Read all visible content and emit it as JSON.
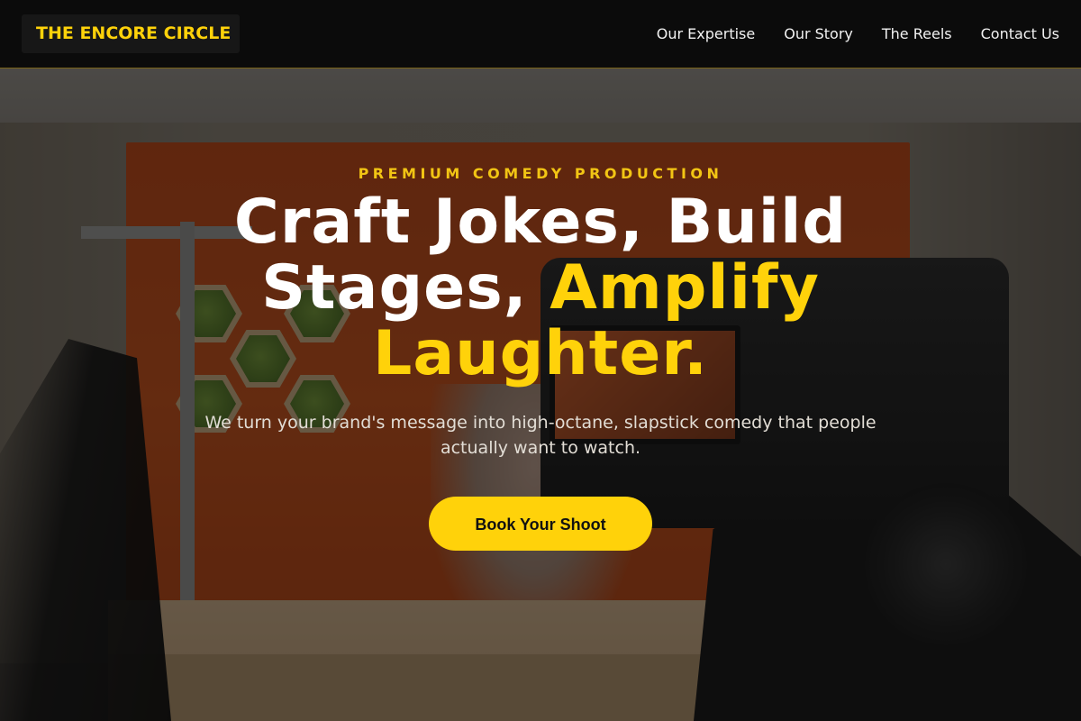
{
  "brand": {
    "name": "THE ENCORE CIRCLE"
  },
  "nav": {
    "items": [
      {
        "label": "Our Expertise"
      },
      {
        "label": "Our Story"
      },
      {
        "label": "The Reels"
      },
      {
        "label": "Contact Us"
      }
    ]
  },
  "hero": {
    "eyebrow": "PREMIUM COMEDY PRODUCTION",
    "headline_part1": "Craft Jokes, Build Stages, ",
    "headline_accent": "Amplify Laughter.",
    "subtitle": "We turn your brand's message into high-octane, slapstick comedy that people actually want to watch.",
    "cta_label": "Book Your Shoot"
  },
  "colors": {
    "accent": "#ffd20a",
    "header_bg": "#0b0b0b",
    "text": "#ffffff"
  }
}
